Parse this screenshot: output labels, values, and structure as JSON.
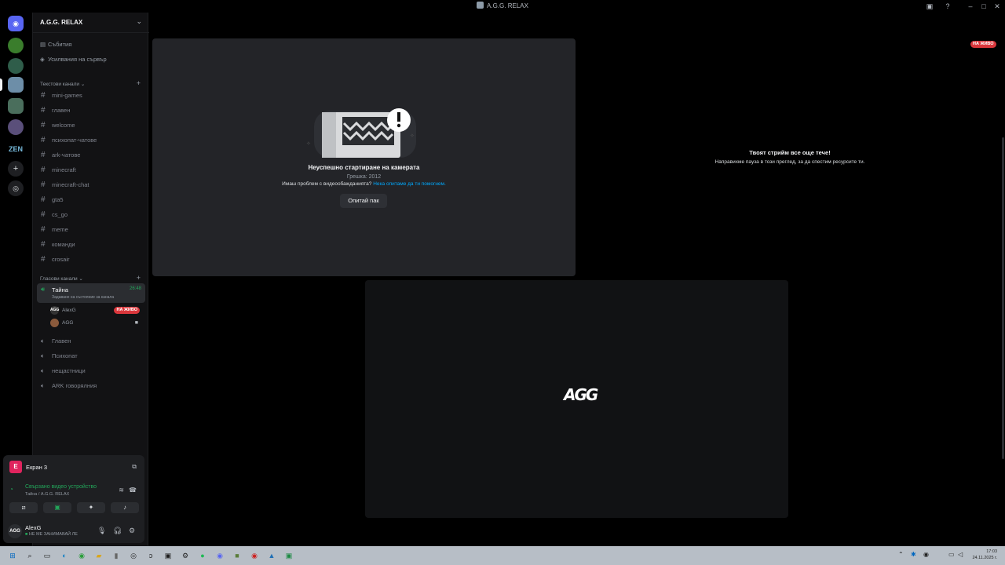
{
  "window": {
    "title": "A.G.G. RELAX"
  },
  "server": {
    "name": "A.G.G. RELAX",
    "menu": [
      "Събития",
      "Усилвания на сървър"
    ],
    "text_category": "Текстови канали",
    "text_channels": [
      "mini-games",
      "главен",
      "welcome",
      "психопат-чатове",
      "ark-чатове",
      "minecraft",
      "minecraft-chat",
      "gta5",
      "cs_go",
      "meme",
      "команди",
      "crosair"
    ],
    "voice_category": "Гласови канали",
    "active_voice": {
      "name": "Тайна",
      "time": "26:48",
      "status": "Задаване на състояние за канала"
    },
    "voice_users": [
      {
        "avatar": "AGG",
        "name": "AlexG",
        "badge": "НА ЖИВО"
      },
      {
        "avatar": "",
        "name": "AGG",
        "badge": ""
      }
    ],
    "voice_channels": [
      "Главен",
      "Психопат",
      "нещастници",
      "ARK говорялния"
    ]
  },
  "panel": {
    "screen_letter": "E",
    "screen_label": "Екран 3",
    "connected": "Свързано видео устройство",
    "connected_sub": "Тайна / A.G.G. RELAX",
    "user": {
      "avatar": "AGG",
      "name": "AlexG",
      "status": "НЕ МЕ ЗАНИМАВАЙ ЛЕ"
    }
  },
  "stage": {
    "error_title": "Неуспешно стартиране на камерата",
    "error_code": "Грешка: 2012",
    "help_text": "Имаш проблем с видеообажданията?",
    "help_link": "Нека опитаме да ти помогнем.",
    "retry_label": "Опитай пак",
    "live_badge": "НА ЖИВО",
    "paused_title": "Твоят стрийм все още тече!",
    "paused_sub": "Направихме пауза в този преглед, за да спестим ресурсите ти.",
    "logo_text": "AGG"
  },
  "taskbar": {
    "time": "17:03",
    "date": "24.11.2025 г."
  },
  "colors": {
    "accent_green": "#23a55a",
    "live_red": "#da373c",
    "link_blue": "#00a8fc"
  }
}
